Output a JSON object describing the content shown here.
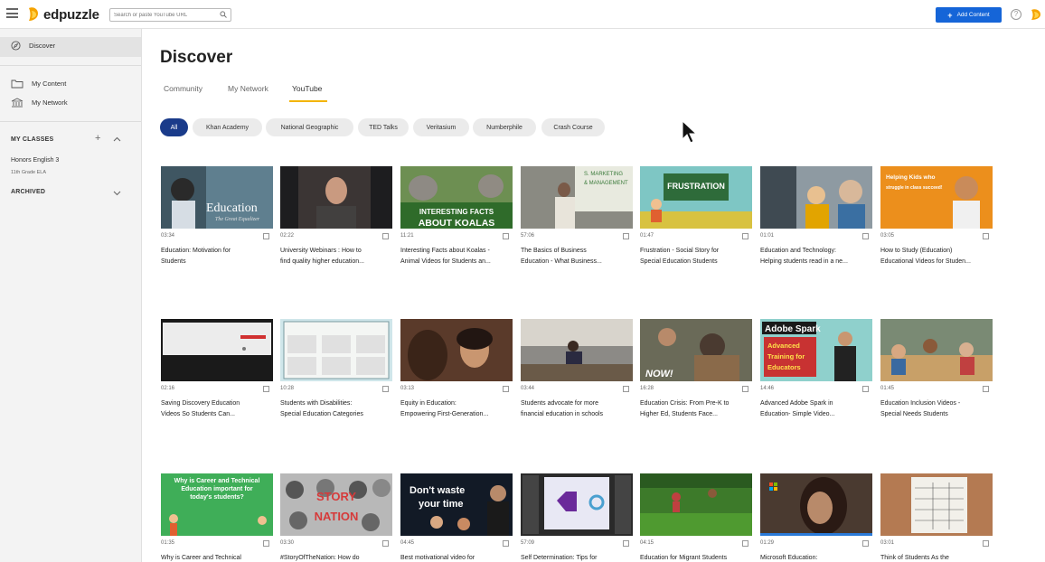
{
  "header": {
    "logo_text": "edpuzzle",
    "search_placeholder": "Search or paste YouTube URL",
    "add_content_label": "Add Content",
    "help_label": "?"
  },
  "sidebar": {
    "discover": "Discover",
    "my_content": "My Content",
    "my_network": "My Network",
    "my_classes": "MY CLASSES",
    "class_name": "Honors English 3",
    "class_grade": "11th Grade ELA",
    "archived": "ARCHIVED"
  },
  "main": {
    "title": "Discover",
    "tabs": [
      "Community",
      "My Network",
      "YouTube"
    ],
    "chips": [
      "All",
      "Khan Academy",
      "National Geographic",
      "TED Talks",
      "Veritasium",
      "Numberphile",
      "Crash Course"
    ]
  },
  "videos": [
    {
      "duration": "03:34",
      "title1": "Education: Motivation for",
      "title2": "Students",
      "overlay": "Education",
      "overlay2": "The Great Equalizer"
    },
    {
      "duration": "02:22",
      "title1": "University Webinars : How to",
      "title2": "find quality higher education..."
    },
    {
      "duration": "11:21",
      "title1": "Interesting Facts about Koalas -",
      "title2": "Animal Videos for Students an...",
      "overlay": "INTERESTING FACTS",
      "overlay2": "ABOUT KOALAS"
    },
    {
      "duration": "57:06",
      "title1": "The Basics of Business",
      "title2": "Education - What Business...",
      "overlay": "S. MARKETING",
      "overlay2": "& MANAGEMENT"
    },
    {
      "duration": "01:47",
      "title1": "Frustration - Social Story for",
      "title2": "Special Education Students",
      "overlay": "FRUSTRATION"
    },
    {
      "duration": "01:01",
      "title1": "Education and Technology:",
      "title2": "Helping students read in a ne..."
    },
    {
      "duration": "03:05",
      "title1": "How to Study (Education)",
      "title2": "Educational Videos for Studen...",
      "overlay": "Helping Kids who",
      "overlay2": "struggle in class succeed!"
    },
    {
      "duration": "02:16",
      "title1": "Saving Discovery Education",
      "title2": "Videos So Students Can..."
    },
    {
      "duration": "10:28",
      "title1": "Students with Disabilities:",
      "title2": "Special Education Categories"
    },
    {
      "duration": "03:13",
      "title1": "Equity in Education:",
      "title2": "Empowering First-Generation..."
    },
    {
      "duration": "03:44",
      "title1": "Students advocate for more",
      "title2": "financial education in schools"
    },
    {
      "duration": "16:28",
      "title1": "Education Crisis: From Pre-K to",
      "title2": "Higher Ed, Students Face...",
      "overlay": "NOW!"
    },
    {
      "duration": "14:46",
      "title1": "Advanced Adobe Spark in",
      "title2": "Education- Simple Video...",
      "overlay": "Adobe Spark",
      "overlay2": "Advanced Training for Educators"
    },
    {
      "duration": "01:45",
      "title1": "Education Inclusion Videos -",
      "title2": "Special Needs Students"
    },
    {
      "duration": "01:35",
      "title1": "Why is Career and Technical",
      "title2": "",
      "overlay": "Why is Career and Technical Education important for today's students?"
    },
    {
      "duration": "03:30",
      "title1": "#StoryOfTheNation: How do",
      "title2": "",
      "overlay": "STORY",
      "overlay2": "NATION"
    },
    {
      "duration": "04:45",
      "title1": "Best motivational video for",
      "title2": "",
      "overlay": "Don't waste",
      "overlay2": "your time"
    },
    {
      "duration": "57:09",
      "title1": "Self Determination: Tips for",
      "title2": ""
    },
    {
      "duration": "04:15",
      "title1": "Education for Migrant Students",
      "title2": ""
    },
    {
      "duration": "01:29",
      "title1": "Microsoft Education:",
      "title2": ""
    },
    {
      "duration": "03:01",
      "title1": "Think of Students As the",
      "title2": ""
    }
  ],
  "colors": {
    "brand_blue": "#1565d8",
    "chip_active": "#1a3b8a",
    "tab_underline": "#f3b400"
  }
}
